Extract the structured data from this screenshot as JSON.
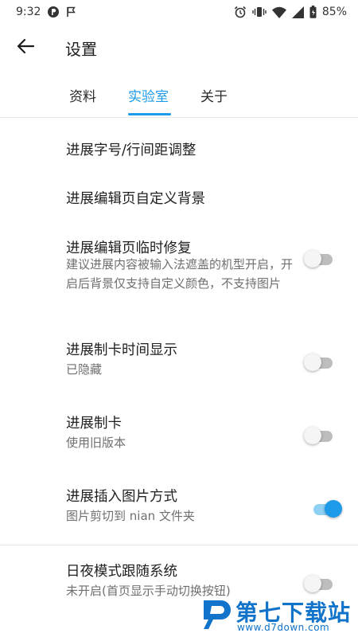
{
  "status_bar": {
    "time": "9:32",
    "battery": "85%",
    "left_icons": [
      "app-notification-icon",
      "flag-icon"
    ],
    "right_icons": [
      "alarm-icon",
      "vibrate-icon",
      "wifi-icon",
      "signal-icon",
      "battery-icon"
    ]
  },
  "app_bar": {
    "title": "设置",
    "back_icon": "arrow-left-icon"
  },
  "tabs": [
    {
      "label": "资料",
      "active": false
    },
    {
      "label": "实验室",
      "active": true
    },
    {
      "label": "关于",
      "active": false
    }
  ],
  "settings": [
    {
      "title": "进展字号/行间距调整",
      "subtitle": "",
      "has_switch": false
    },
    {
      "title": "进展编辑页自定义背景",
      "subtitle": "",
      "has_switch": false
    },
    {
      "title": "进展编辑页临时修复",
      "subtitle": "建议进展内容被输入法遮盖的机型开启，开启后背景仅支持自定义颜色，不支持图片",
      "has_switch": true,
      "on": false
    },
    {
      "title": "进展制卡时间显示",
      "subtitle": "已隐藏",
      "has_switch": true,
      "on": false
    },
    {
      "title": "进展制卡",
      "subtitle": "使用旧版本",
      "has_switch": true,
      "on": false
    },
    {
      "title": "进展插入图片方式",
      "subtitle": "图片剪切到 nian 文件夹",
      "has_switch": true,
      "on": true
    },
    {
      "title": "日夜模式跟随系统",
      "subtitle": "未开启(首页显示手动切换按钮)",
      "has_switch": true,
      "on": false
    }
  ],
  "watermark": {
    "brand": "第七下载站",
    "url": "www.d7down.com"
  },
  "colors": {
    "accent": "#1e9be8",
    "switch_on_track": "#8fd0f5",
    "switch_off_track": "#bdbdbd",
    "watermark": "#1173c9"
  }
}
